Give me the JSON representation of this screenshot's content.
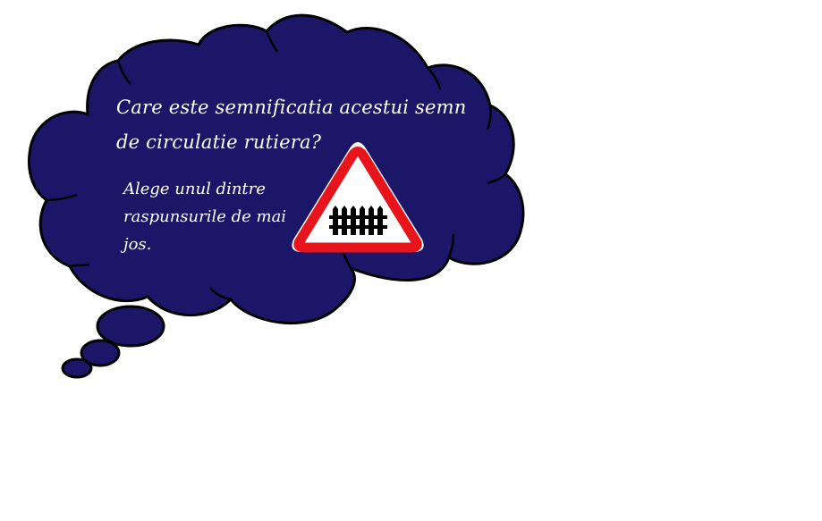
{
  "slide": {
    "question": {
      "line1": "Care este semnificatia acestui semn",
      "line2": "de circulatie rutiera?"
    },
    "instruction": {
      "line1": "Alege unul dintre",
      "line2": "raspunsurile de mai",
      "line3": "jos."
    },
    "sign": {
      "icon": "railway-crossing-with-barrier-warning-sign",
      "border_color": "#e8141b",
      "fill_color": "#ffffff",
      "symbol_color": "#000000"
    }
  },
  "colors": {
    "cloud_fill": "#1c1668",
    "cloud_outline": "#000000",
    "text": "#ffffff",
    "background": "#ffffff"
  }
}
